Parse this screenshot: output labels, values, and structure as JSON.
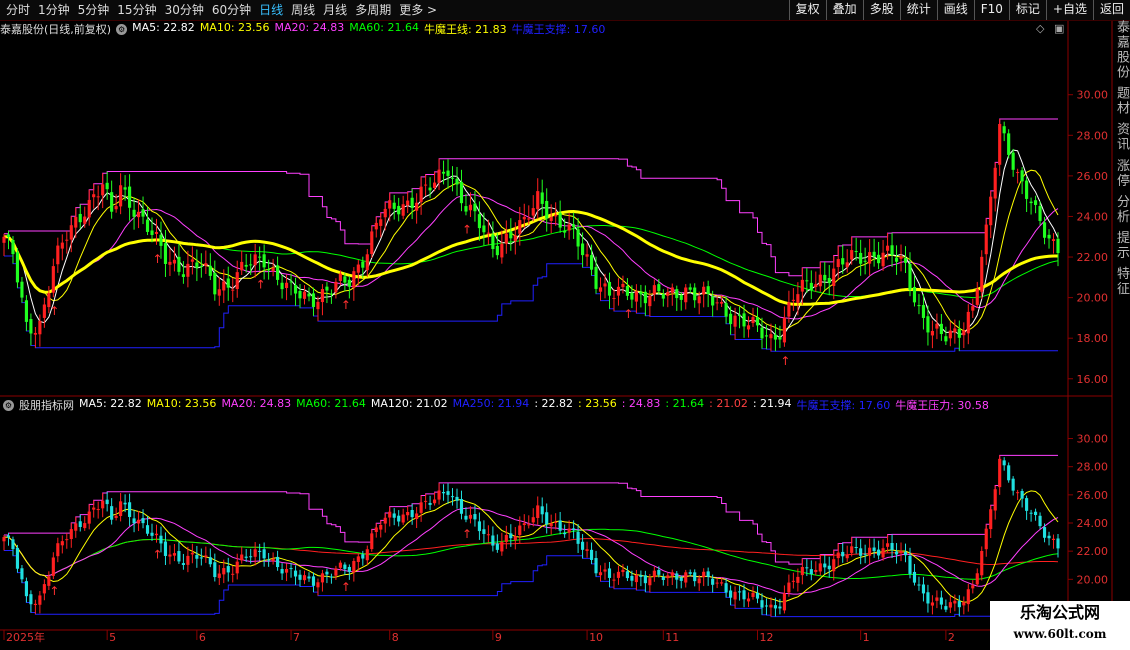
{
  "toolbar": {
    "left_items": [
      "分时",
      "1分钟",
      "5分钟",
      "15分钟",
      "30分钟",
      "60分钟",
      "日线",
      "周线",
      "月线",
      "多周期",
      "更多 >"
    ],
    "active": "日线",
    "right_buttons": [
      "复权",
      "叠加",
      "多股",
      "统计",
      "画线",
      "F10",
      "标记",
      "+自选",
      "返回"
    ]
  },
  "main_legend": {
    "stock": "泰嘉股份(日线,前复权)",
    "items": [
      {
        "text": "MA5: 22.82",
        "color": "#ffffff"
      },
      {
        "text": "MA10: 23.56",
        "color": "#ffff00"
      },
      {
        "text": "MA20: 24.83",
        "color": "#ff40ff"
      },
      {
        "text": "MA60: 21.64",
        "color": "#00ff00"
      },
      {
        "text": "牛魔王线: 21.83",
        "color": "#ffff00"
      },
      {
        "text": "牛魔王支撑: 17.60",
        "color": "#2020ff"
      }
    ]
  },
  "sub_legend": {
    "name": "股朋指标网",
    "items": [
      {
        "text": "MA5: 22.82",
        "color": "#ffffff"
      },
      {
        "text": "MA10: 23.56",
        "color": "#ffff00"
      },
      {
        "text": "MA20: 24.83",
        "color": "#ff40ff"
      },
      {
        "text": "MA60: 21.64",
        "color": "#00ff00"
      },
      {
        "text": "MA120: 21.02",
        "color": "#ffffff"
      },
      {
        "text": "MA250: 21.94",
        "color": "#2020ff"
      },
      {
        "text": ": 22.82",
        "color": "#ffffff"
      },
      {
        "text": ": 23.56",
        "color": "#ffff00"
      },
      {
        "text": ": 24.83",
        "color": "#ff40ff"
      },
      {
        "text": ": 21.64",
        "color": "#00ff00"
      },
      {
        "text": ": 21.02",
        "color": "#ff4040"
      },
      {
        "text": ": 21.94",
        "color": "#ffffff"
      },
      {
        "text": "牛魔王支撑: 17.60",
        "color": "#2020ff"
      },
      {
        "text": "牛魔王压力: 30.58",
        "color": "#ff40ff"
      }
    ]
  },
  "right_strip_text": "泰嘉股份 题材 资讯 涨停 分析 提示 特征",
  "watermark": {
    "line1": "乐淘公式网",
    "line2": "www.60lt.com"
  },
  "chart_data": {
    "type": "candlestick",
    "title": "泰嘉股份(日线,前复权)",
    "y_ticks_main": [
      16.0,
      18.0,
      20.0,
      22.0,
      24.0,
      26.0,
      28.0,
      30.0
    ],
    "y_ticks_sub": [
      18.0,
      20.0,
      22.0,
      24.0,
      26.0,
      28.0,
      30.0
    ],
    "ylim_main": [
      15.2,
      32.5
    ],
    "ylim_sub": [
      16.4,
      31.6
    ],
    "x_month_labels": [
      "2025年",
      "5",
      "6",
      "7",
      "8",
      "9",
      "10",
      "11",
      "12",
      "1",
      "2"
    ],
    "x_month_index": [
      0,
      23,
      43,
      64,
      86,
      109,
      130,
      147,
      168,
      191,
      210
    ],
    "anchors_close": [
      [
        0,
        23.0
      ],
      [
        2,
        22.0
      ],
      [
        5,
        18.5
      ],
      [
        8,
        18.8
      ],
      [
        11,
        21.5
      ],
      [
        14,
        23.0
      ],
      [
        18,
        24.5
      ],
      [
        22,
        25.5
      ],
      [
        24,
        24.0
      ],
      [
        26,
        25.5
      ],
      [
        29,
        24.5
      ],
      [
        33,
        23.0
      ],
      [
        36,
        22.0
      ],
      [
        40,
        21.5
      ],
      [
        44,
        21.5
      ],
      [
        47,
        20.6
      ],
      [
        51,
        20.8
      ],
      [
        54,
        21.5
      ],
      [
        58,
        22.0
      ],
      [
        61,
        21.0
      ],
      [
        64,
        20.2
      ],
      [
        68,
        20.0
      ],
      [
        73,
        20.4
      ],
      [
        77,
        20.8
      ],
      [
        80,
        22.0
      ],
      [
        84,
        24.0
      ],
      [
        88,
        24.5
      ],
      [
        92,
        25.0
      ],
      [
        96,
        25.5
      ],
      [
        99,
        26.5
      ],
      [
        101,
        25.5
      ],
      [
        103,
        24.5
      ],
      [
        106,
        23.5
      ],
      [
        109,
        22.5
      ],
      [
        112,
        23.0
      ],
      [
        116,
        23.5
      ],
      [
        119,
        25.0
      ],
      [
        121,
        24.5
      ],
      [
        124,
        23.5
      ],
      [
        127,
        23.0
      ],
      [
        130,
        22.0
      ],
      [
        132,
        21.0
      ],
      [
        135,
        20.0
      ],
      [
        139,
        20.3
      ],
      [
        144,
        20.2
      ],
      [
        148,
        20.0
      ],
      [
        152,
        20.5
      ],
      [
        156,
        20.0
      ],
      [
        160,
        19.5
      ],
      [
        164,
        19.0
      ],
      [
        168,
        18.3
      ],
      [
        171,
        18.0
      ],
      [
        173,
        18.5
      ],
      [
        176,
        20.0
      ],
      [
        179,
        20.5
      ],
      [
        182,
        21.0
      ],
      [
        186,
        21.5
      ],
      [
        190,
        22.0
      ],
      [
        194,
        22.2
      ],
      [
        198,
        22.0
      ],
      [
        201,
        21.5
      ],
      [
        204,
        19.5
      ],
      [
        207,
        18.2
      ],
      [
        210,
        18.0
      ],
      [
        213,
        18.5
      ],
      [
        216,
        19.5
      ],
      [
        219,
        23.0
      ],
      [
        222,
        28.5
      ],
      [
        224,
        27.5
      ],
      [
        226,
        26.0
      ],
      [
        228,
        25.0
      ],
      [
        230,
        24.0
      ],
      [
        233,
        23.0
      ],
      [
        235,
        22.6
      ]
    ],
    "ma_lines": [
      "MA5",
      "MA10",
      "MA20",
      "MA60",
      "牛魔王线",
      "牛魔王支撑",
      "牛魔王压力"
    ],
    "support_last": 17.6,
    "resistance_last": 30.58,
    "ma5_last": 22.82,
    "ma10_last": 23.56,
    "ma20_last": 24.83,
    "ma60_last": 21.64,
    "ma120_last": 21.02,
    "ma250_last": 21.94,
    "nmw_last": 21.83
  },
  "colors": {
    "up": "#ff2020",
    "down": "#20e0e0",
    "down_main": "#20ff20",
    "axis": "#8b0000"
  }
}
